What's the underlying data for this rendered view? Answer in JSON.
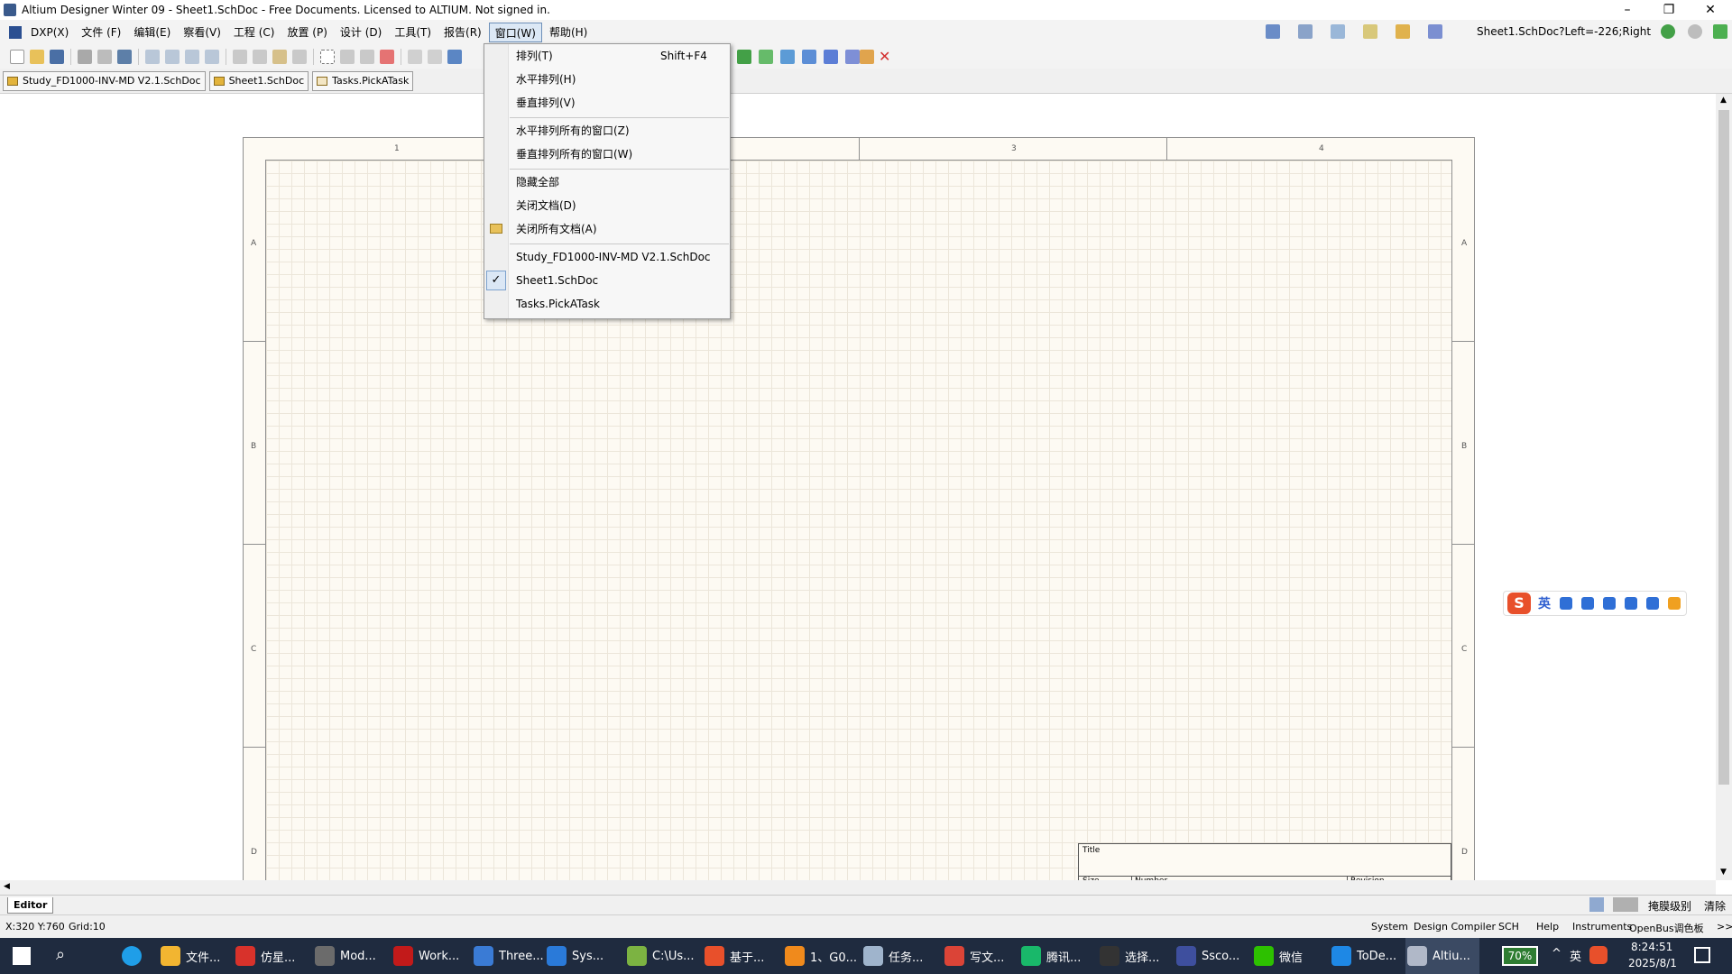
{
  "window": {
    "title": "Altium Designer Winter 09 - Sheet1.SchDoc - Free Documents. Licensed to ALTIUM. Not signed in.",
    "minimize": "–",
    "maximize": "❐",
    "close": "✕"
  },
  "menubar": {
    "items": [
      {
        "label": "DXP(X)"
      },
      {
        "label": "文件 (F)"
      },
      {
        "label": "编辑(E)"
      },
      {
        "label": "察看(V)"
      },
      {
        "label": "工程 (C)"
      },
      {
        "label": "放置 (P)"
      },
      {
        "label": "设计 (D)"
      },
      {
        "label": "工具(T)"
      },
      {
        "label": "报告(R)"
      },
      {
        "label": "窗口(W)"
      },
      {
        "label": "帮助(H)"
      }
    ],
    "active_index": 9,
    "location_text": "Sheet1.SchDoc?Left=-226;Right"
  },
  "doc_tabs": [
    {
      "label": "Study_FD1000-INV-MD V2.1.SchDoc"
    },
    {
      "label": "Sheet1.SchDoc"
    },
    {
      "label": "Tasks.PickATask"
    }
  ],
  "window_menu": {
    "items": [
      {
        "label": "排列(T)",
        "shortcut": "Shift+F4"
      },
      {
        "label": "水平排列(H)"
      },
      {
        "label": "垂直排列(V)"
      },
      {
        "label": "水平排列所有的窗口(Z)"
      },
      {
        "label": "垂直排列所有的窗口(W)"
      },
      {
        "label": "隐藏全部"
      },
      {
        "label": "关闭文档(D)"
      },
      {
        "label": "关闭所有文档(A)"
      },
      {
        "label": "Study_FD1000-INV-MD V2.1.SchDoc"
      },
      {
        "label": "Sheet1.SchDoc",
        "checked": true
      },
      {
        "label": "Tasks.PickATask"
      }
    ],
    "check_mark": "✓"
  },
  "sheet": {
    "columns": [
      "1",
      "3",
      "4"
    ],
    "rows": [
      "A",
      "B",
      "C",
      "D"
    ],
    "titleblock": {
      "title": "Title",
      "size": "Size",
      "number": "Number",
      "revision": "Revision"
    }
  },
  "editor_tab": "Editor",
  "editor_right": {
    "mask_level": "掩膜级别",
    "clear": "清除"
  },
  "status": {
    "coords": "X:320 Y:760",
    "grid": "Grid:10",
    "panels": [
      "System",
      "Design Compiler",
      "SCH",
      "Help",
      "Instruments",
      "OpenBus调色板",
      ">>"
    ]
  },
  "ime": {
    "logo": "S",
    "lang": "英"
  },
  "taskbar": {
    "apps": [
      {
        "label": "文件...",
        "color": "#f2b531"
      },
      {
        "label": "仿星...",
        "color": "#d8322b"
      },
      {
        "label": "Mod...",
        "color": "#6b6b6b"
      },
      {
        "label": "Work...",
        "color": "#c21a1a"
      },
      {
        "label": "Three...",
        "color": "#3a7bd5"
      },
      {
        "label": "Sys...",
        "color": "#2a7ad9"
      },
      {
        "label": "C:\\Us...",
        "color": "#7cb342"
      },
      {
        "label": "基于...",
        "color": "#e8502b"
      },
      {
        "label": "1、G0...",
        "color": "#f08a1c"
      },
      {
        "label": "任务...",
        "color": "#9fb4cc"
      },
      {
        "label": "写文...",
        "color": "#db4437"
      },
      {
        "label": "腾讯...",
        "color": "#19b86a"
      },
      {
        "label": "选择...",
        "color": "#333333"
      },
      {
        "label": "Ssco...",
        "color": "#3e4f9e"
      },
      {
        "label": "微信",
        "color": "#2dc100"
      },
      {
        "label": "ToDe...",
        "color": "#1e88e5"
      },
      {
        "label": "Altiu...",
        "color": "#b0b8c8"
      }
    ],
    "battery": "70%",
    "lang": "英",
    "time": "8:24:51",
    "date": "2025/8/1"
  },
  "colors": {
    "menu_highlight": "#dce8f5",
    "taskbar": "#1f2b3f",
    "sheet": "#fdfaf3"
  }
}
